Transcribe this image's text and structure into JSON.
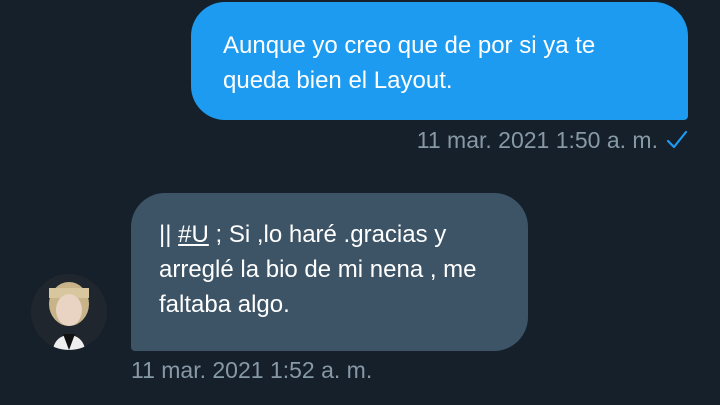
{
  "messages": {
    "outgoing": {
      "text": "Aunque yo creo que de por si ya te queda bien el Layout.",
      "timestamp": "11 mar. 2021 1:50 a. m.",
      "status_icon": "check-icon",
      "bubble_color": "#1d9bf0"
    },
    "incoming": {
      "text_prefix": "|| ",
      "hashtag": "#U",
      "text_rest": " ; Si ,lo haré .gracias y arreglé la bio de mi nena , me faltaba algo.",
      "timestamp": "11 mar. 2021 1:52 a. m.",
      "bubble_color": "#3d5466",
      "avatar_icon": "user-avatar"
    }
  },
  "colors": {
    "background": "#15202b",
    "meta_text": "#8899a6",
    "check": "#1d9bf0"
  }
}
